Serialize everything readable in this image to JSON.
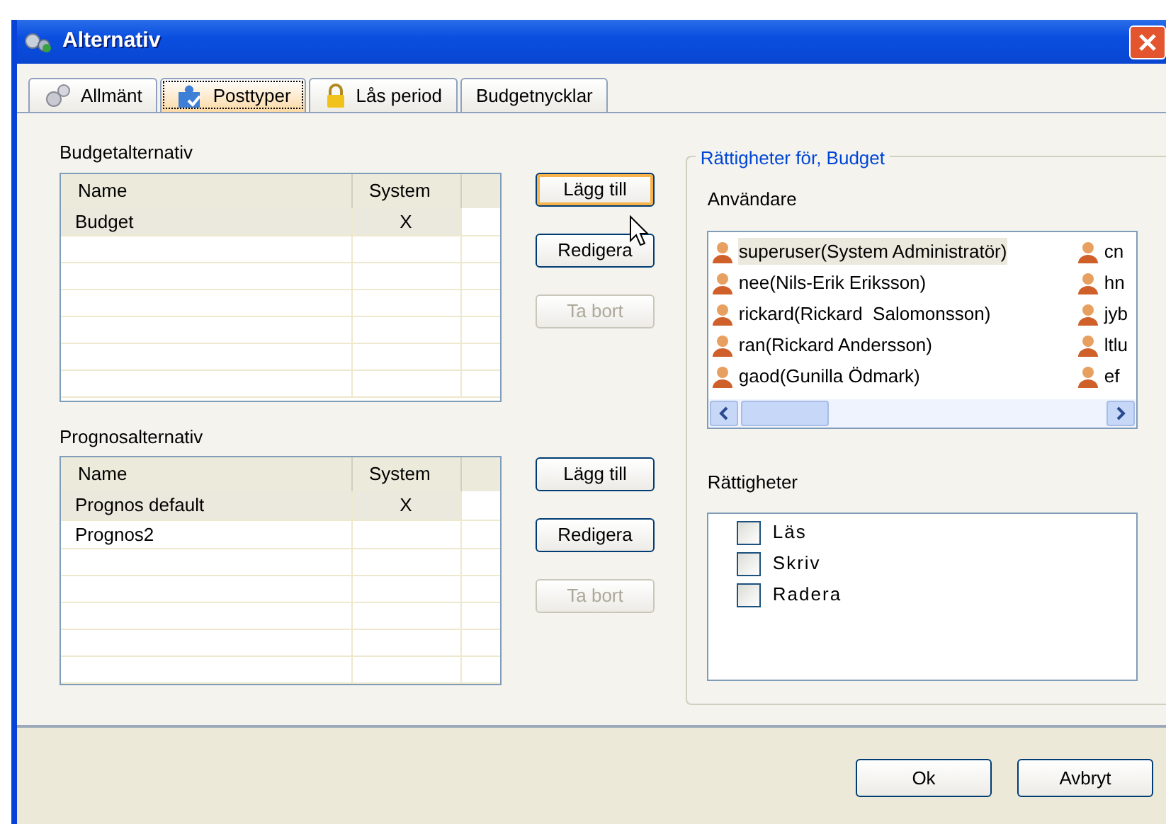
{
  "window": {
    "title": "Alternativ"
  },
  "tabs": [
    {
      "label": "Allmänt",
      "kind": "gears",
      "selected": false
    },
    {
      "label": "Posttyper",
      "kind": "puzzle",
      "selected": true
    },
    {
      "label": "Lås period",
      "kind": "lock",
      "selected": false
    },
    {
      "label": "Budgetnycklar",
      "kind": "plain",
      "selected": false
    }
  ],
  "sections": [
    {
      "label": "Budgetalternativ",
      "columns": [
        "Name",
        "System"
      ],
      "rows": [
        {
          "name": "Budget",
          "system": "X",
          "selected": true
        }
      ],
      "buttons": [
        {
          "label": "Lägg till",
          "disabled": false,
          "focused": true
        },
        {
          "label": "Redigera",
          "disabled": false,
          "focused": false
        },
        {
          "label": "Ta bort",
          "disabled": true,
          "focused": false
        }
      ]
    },
    {
      "label": "Prognosalternativ",
      "columns": [
        "Name",
        "System"
      ],
      "rows": [
        {
          "name": "Prognos default",
          "system": "X",
          "selected": true
        },
        {
          "name": "Prognos2",
          "system": "",
          "selected": false
        }
      ],
      "buttons": [
        {
          "label": "Lägg till",
          "disabled": false,
          "focused": false
        },
        {
          "label": "Redigera",
          "disabled": false,
          "focused": false
        },
        {
          "label": "Ta bort",
          "disabled": true,
          "focused": false
        }
      ]
    }
  ],
  "rights_group": {
    "title": "Rättigheter för, Budget",
    "users_label": "Användare",
    "users": [
      {
        "name": "superuser(System Administratör)",
        "selected": true
      },
      {
        "name": "nee(Nils-Erik Eriksson)",
        "selected": false
      },
      {
        "name": "rickard(Rickard  Salomonsson)",
        "selected": false
      },
      {
        "name": "ran(Rickard Andersson)",
        "selected": false
      },
      {
        "name": "gaod(Gunilla Ödmark)",
        "selected": false
      },
      {
        "name": "cn",
        "selected": false
      },
      {
        "name": "hn",
        "selected": false
      },
      {
        "name": "jyb",
        "selected": false
      },
      {
        "name": "ltlu",
        "selected": false
      },
      {
        "name": "ef",
        "selected": false
      }
    ],
    "rights_label": "Rättigheter",
    "rights": [
      {
        "label": "Läs",
        "checked": false
      },
      {
        "label": "Skriv",
        "checked": false
      },
      {
        "label": "Radera",
        "checked": false
      }
    ]
  },
  "buttons": [
    {
      "label": "Ok"
    },
    {
      "label": "Avbryt"
    }
  ]
}
